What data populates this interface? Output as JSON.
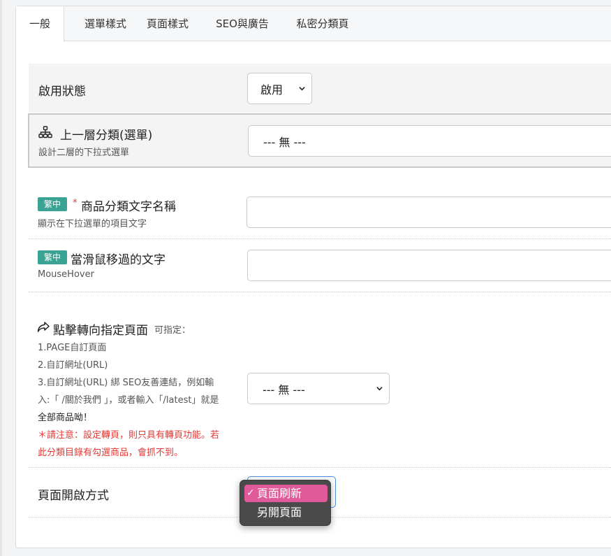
{
  "tabs": [
    {
      "label": "一般",
      "active": true
    },
    {
      "label": "選單樣式",
      "active": false
    },
    {
      "label": "頁面樣式",
      "active": false
    },
    {
      "label": "SEO與廣告",
      "active": false
    },
    {
      "label": "私密分類頁",
      "active": false
    }
  ],
  "status": {
    "label": "啟用狀態",
    "value": "啟用"
  },
  "parent": {
    "icon": "sitemap-icon",
    "label": "上一層分類(選單)",
    "sub": "設計二層的下拉式選單",
    "value": "--- 無 ---"
  },
  "name_field": {
    "badge": "繁中",
    "required_mark": "*",
    "label": "商品分類文字名稱",
    "sub": "顯示在下拉選單的項目文字",
    "value": ""
  },
  "hover_field": {
    "badge": "繁中",
    "label": "當滑鼠移過的文字",
    "sub": "MouseHover",
    "value": ""
  },
  "redirect": {
    "icon": "share-arrow-icon",
    "label": "點擊轉向指定頁面",
    "hint": "可指定：",
    "lines": [
      "1.PAGE自訂頁面",
      "2.自訂網址(URL)",
      "3.自訂網址(URL) 綁 SEO友善連結，例如輸",
      "入:「 /關於我們 」，或者輸入「/latest」就是",
      "全部商品呦！"
    ],
    "warn": [
      "＊請注意：設定轉頁，則只具有轉頁功能。若",
      "此分類目錄有勾選商品，會抓不到。"
    ],
    "value": "--- 無 ---"
  },
  "open_mode": {
    "label": "頁面開啟方式",
    "options": [
      "頁面刷新",
      "另開頁面"
    ],
    "selected": "頁面刷新",
    "check": "✓"
  },
  "colors": {
    "badge": "#3aa394",
    "required": "#e53935",
    "warning": "#e53935",
    "dropdown_selected": "#e05a9a"
  }
}
